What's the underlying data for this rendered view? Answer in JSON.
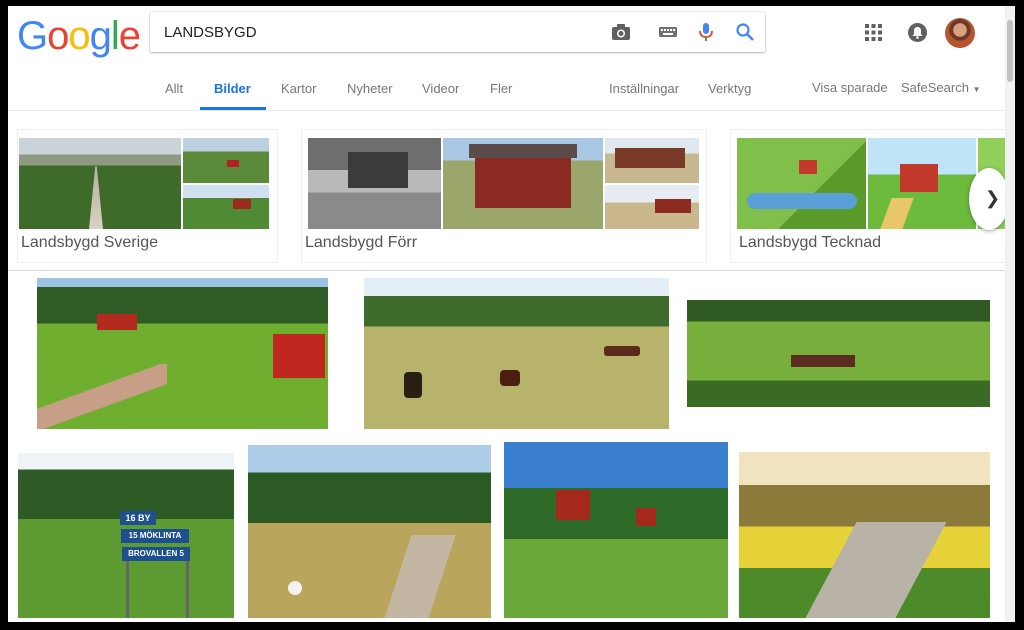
{
  "search": {
    "query": "LANDSBYGD"
  },
  "icons": {
    "camera": "camera-icon",
    "keyboard": "keyboard-icon",
    "mic": "mic-icon",
    "search": "search-icon",
    "apps": "apps-grid-icon",
    "notifications": "notifications-icon"
  },
  "brand": {
    "letters": [
      "G",
      "o",
      "o",
      "g",
      "l",
      "e"
    ],
    "colors": [
      "#4285F4",
      "#EA4335",
      "#FBBC05",
      "#4285F4",
      "#34A853",
      "#EA4335"
    ]
  },
  "nav": {
    "tabs": [
      {
        "label": "Allt"
      },
      {
        "label": "Bilder"
      },
      {
        "label": "Kartor"
      },
      {
        "label": "Nyheter"
      },
      {
        "label": "Videor"
      },
      {
        "label": "Fler"
      }
    ],
    "settings": "Inställningar",
    "tools": "Verktyg",
    "saved": "Visa sparade",
    "safesearch": "SafeSearch"
  },
  "suggestions": [
    {
      "label": "Landsbygd Sverige"
    },
    {
      "label": "Landsbygd Förr"
    },
    {
      "label": "Landsbygd Tecknad"
    }
  ],
  "signs": [
    "16 BY",
    "15 MÖKLINTA",
    "BROVALLEN 5"
  ],
  "colors": {
    "accent": "#1a73e8",
    "text": "#555555"
  }
}
